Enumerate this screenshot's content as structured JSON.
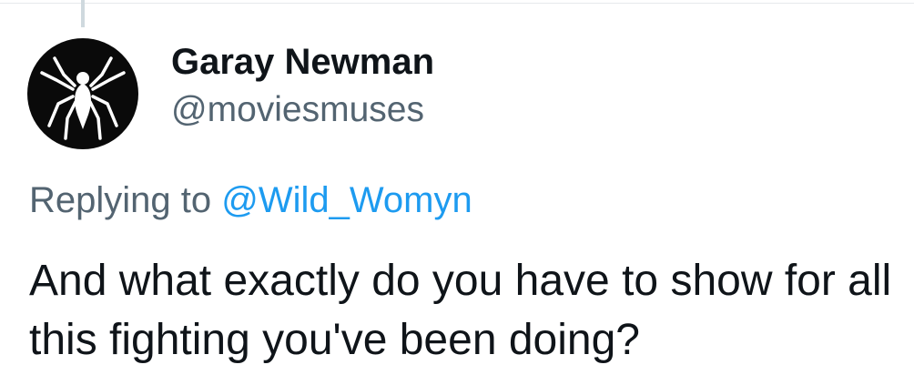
{
  "tweet": {
    "author": {
      "display_name": "Garay Newman",
      "handle": "@moviesmuses",
      "avatar_icon": "spider-emblem-icon"
    },
    "replying_prefix": "Replying to",
    "replying_to": "@Wild_Womyn",
    "text": "And what exactly do you have to show for all this fighting you've been doing?"
  },
  "colors": {
    "link": "#1d9bf0",
    "secondary_text": "#536471",
    "primary_text": "#0f1419",
    "thread_line": "#cfd9de",
    "avatar_bg": "#0a0a0a"
  }
}
